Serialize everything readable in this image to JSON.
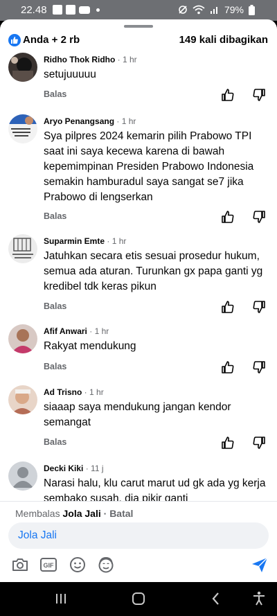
{
  "status_bar": {
    "time": "22.48",
    "battery": "79%"
  },
  "summary": {
    "reactors": "Anda + 2 rb",
    "shares": "149 kali dibagikan"
  },
  "comments": [
    {
      "name": "Ridho Thok Ridho",
      "time": "1 hr",
      "text": "setujuuuuu",
      "reply": "Balas"
    },
    {
      "name": "Aryo Penangsang",
      "time": "1 hr",
      "text": "Sya pilpres 2024 kemarin pilih Prabowo TPI saat ini saya kecewa karena di bawah kepemimpinan Presiden Prabowo Indonesia semakin hamburadul saya sangat se7 jika Prabowo di lengserkan",
      "reply": "Balas"
    },
    {
      "name": "Suparmin Emte",
      "time": "1 hr",
      "text": "Jatuhkan secara etis sesuai prosedur hukum, semua ada aturan. Turunkan gx papa ganti yg kredibel tdk keras pikun",
      "reply": "Balas"
    },
    {
      "name": "Afif Anwari",
      "time": "1 hr",
      "text": "Rakyat mendukung",
      "reply": "Balas"
    },
    {
      "name": "Ad Trisno",
      "time": "1 hr",
      "text": "siaaap saya mendukung jangan kendor semangat",
      "reply": "Balas"
    },
    {
      "name": "Decki Kiki",
      "time": "11 j",
      "text": "Narasi halu, klu carut marut ud gk ada yg kerja sembako susah, dia pikir ganti",
      "reply": ""
    }
  ],
  "reply_bar": {
    "prefix": "Membalas",
    "target": "Jola Jali",
    "cancel": "· Batal",
    "input_value": "Jola Jali"
  },
  "colors": {
    "accent": "#1877f2",
    "secondary_text": "#65676b"
  },
  "icons": [
    "camera-icon",
    "gif-icon",
    "emoji-icon",
    "avatar-sticker-icon",
    "send-icon",
    "thumbs-up-icon",
    "thumbs-down-icon"
  ]
}
